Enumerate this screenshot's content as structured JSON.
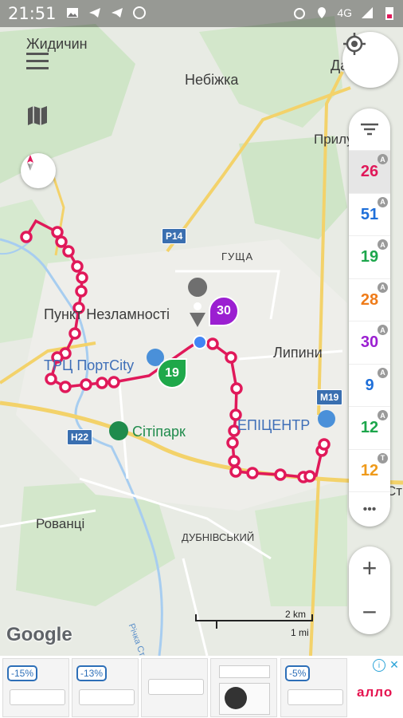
{
  "status_bar": {
    "time": "21:51",
    "network": "4G"
  },
  "map": {
    "labels": {
      "zhydychyn": "Жидичин",
      "nebizhka": "Небіжка",
      "dachne": "Дач",
      "prylutske": "Прилуцьке",
      "hushcha": "ГУЩА",
      "punkt": "Пункт Незламності",
      "lypyny": "Липини",
      "portcity": "ТРЦ ПортCity",
      "epicentr": "ЕПІЦЕНТР",
      "sitipark": "Сітіпарк",
      "rovantsi": "Рованці",
      "dubnivskyi": "ДУБНІВСЬКИЙ",
      "richka": "Річка Стир",
      "str": "Стр"
    },
    "road_shields": {
      "p14": "P14",
      "h22": "H22",
      "m19": "M19"
    },
    "scale": {
      "km": "2 km",
      "mi": "1 mi"
    },
    "google_logo": "Google",
    "bus_markers": [
      {
        "route": "30",
        "color": "#9b1fd1"
      },
      {
        "route": "19",
        "color": "#1fa84a"
      }
    ]
  },
  "routes": [
    {
      "number": "26",
      "color": "#e0195a",
      "badge": "A",
      "selected": true
    },
    {
      "number": "51",
      "color": "#1e6fd9",
      "badge": "A",
      "selected": false
    },
    {
      "number": "19",
      "color": "#1ca64b",
      "badge": "A",
      "selected": false
    },
    {
      "number": "28",
      "color": "#ef7c1a",
      "badge": "A",
      "selected": false
    },
    {
      "number": "30",
      "color": "#9b1fd1",
      "badge": "A",
      "selected": false
    },
    {
      "number": "9",
      "color": "#1e6fd9",
      "badge": "A",
      "selected": false
    },
    {
      "number": "12",
      "color": "#1ca64b",
      "badge": "A",
      "selected": false
    },
    {
      "number": "12",
      "color": "#ef9a1a",
      "badge": "T",
      "selected": false
    }
  ],
  "route_panel": {
    "more": "•••"
  },
  "zoom": {
    "plus": "+",
    "minus": "−"
  },
  "ad": {
    "discounts": [
      "-15%",
      "-13%",
      "",
      "",
      "-5%"
    ],
    "brand": "алло"
  }
}
